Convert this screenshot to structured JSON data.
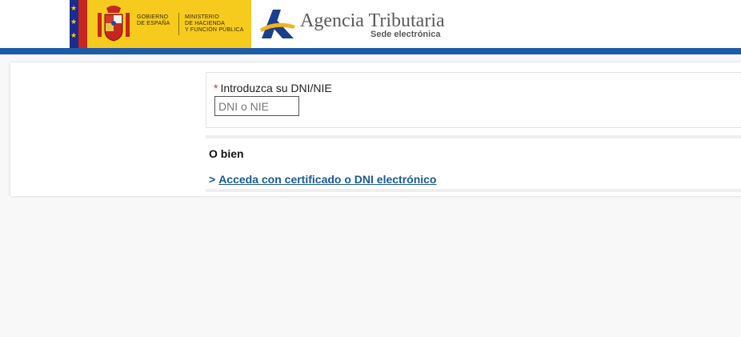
{
  "header": {
    "gov_line1": "Gobierno",
    "gov_line2": "de España",
    "ministry_line1": "Ministerio",
    "ministry_line2": "de Hacienda",
    "ministry_line3": "y Función Pública",
    "agency_name": "Agencia Tributaria",
    "agency_subtitle": "Sede electrónica",
    "brand_color": "#1e5ba8",
    "gov_yellow": "#f6cb1d"
  },
  "form": {
    "required_mark": "*",
    "dni_label": "Introduzca su DNI/NIE",
    "dni_placeholder": "DNI o NIE",
    "dni_value": ""
  },
  "alternative": {
    "title": "O bien",
    "link_prefix": ">",
    "link_text": "Acceda con certificado o DNI electrónico"
  }
}
